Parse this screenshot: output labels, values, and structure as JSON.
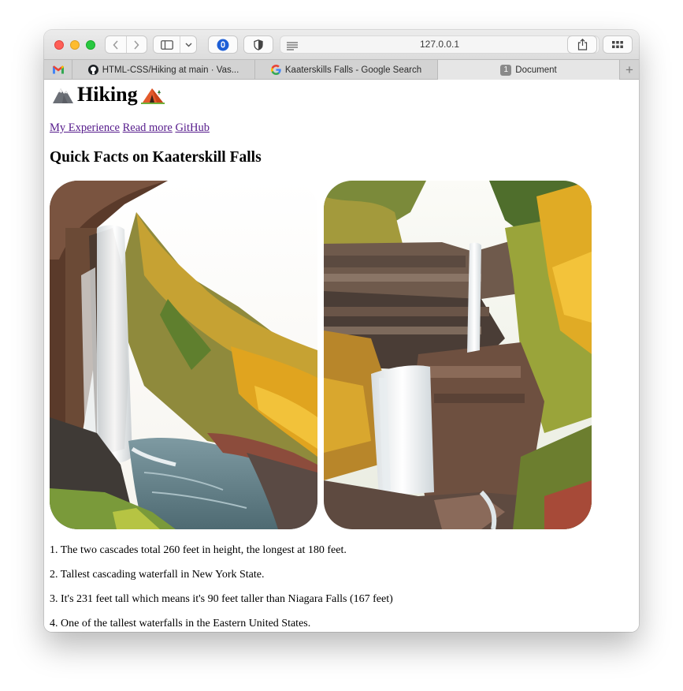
{
  "browser": {
    "url": "127.0.0.1",
    "tabs": [
      {
        "label": "",
        "icon": "gmail-icon"
      },
      {
        "label": "HTML-CSS/Hiking at main · Vas...",
        "icon": "github-icon"
      },
      {
        "label": "Kaaterskills Falls - Google Search",
        "icon": "google-icon"
      },
      {
        "label": "Document",
        "icon": "badge-icon",
        "badge": "1",
        "active": true
      }
    ],
    "new_tab": "+"
  },
  "page": {
    "title": "Hiking",
    "title_icons": [
      "mountain-icon",
      "tent-icon"
    ],
    "links": [
      "My Experience",
      "Read more",
      "GitHub"
    ],
    "heading": "Quick Facts on Kaaterskill Falls",
    "images": [
      {
        "name": "waterfall-photo-side-view"
      },
      {
        "name": "waterfall-photo-front-view"
      }
    ],
    "facts": [
      "1. The two cascades total 260 feet in height, the longest at 180 feet.",
      "2. Tallest cascading waterfall in New York State.",
      "3. It's 231 feet tall which means it's 90 feet taller than Niagara Falls (167 feet)",
      "4. One of the tallest waterfalls in the Eastern United States."
    ]
  },
  "colors": {
    "link": "#551a8b",
    "close": "#ff5f57",
    "minimize": "#febc2e",
    "zoom": "#28c840"
  }
}
